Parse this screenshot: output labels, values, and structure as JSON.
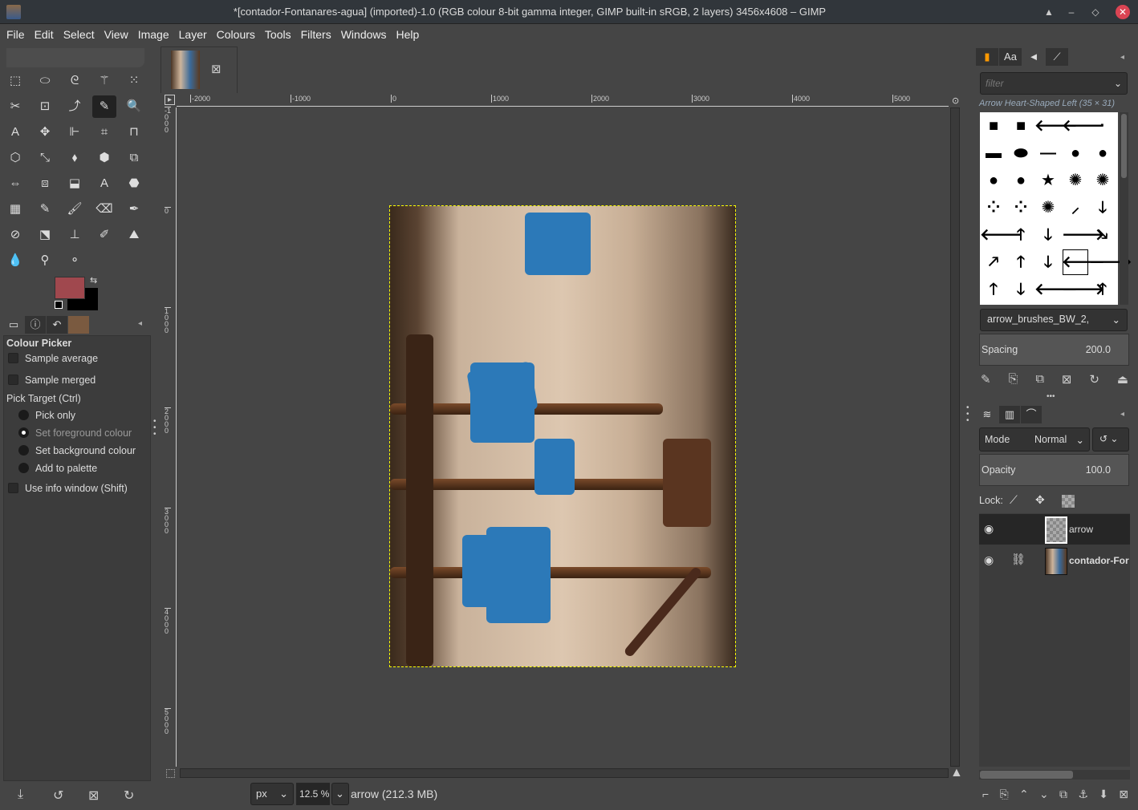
{
  "window": {
    "title": "*[contador-Fontanares-agua] (imported)-1.0 (RGB colour 8-bit gamma integer, GIMP built-in sRGB, 2 layers) 3456x4608 – GIMP"
  },
  "menu": [
    "File",
    "Edit",
    "Select",
    "View",
    "Image",
    "Layer",
    "Colours",
    "Tools",
    "Filters",
    "Windows",
    "Help"
  ],
  "tools": [
    "⬚",
    "⬭",
    "ᘓ",
    "⚚",
    "⁙",
    "✂",
    "⊡",
    "⤴",
    "✎",
    "🔍",
    "A",
    "✥",
    "⊩",
    "⌗",
    "⊓",
    "⬡",
    "⤡",
    "⬧",
    "⬢",
    "⧉",
    "⇔",
    "⧈",
    "⬓",
    "A",
    "⬣",
    "▦",
    "✎",
    "🖌",
    "⌫",
    "✒",
    "⊘",
    "⬔",
    "⊥",
    "✐",
    "⛰",
    "💧",
    "⚲",
    "⚬"
  ],
  "colors": {
    "foreground": "#a0484e",
    "background": "#000000"
  },
  "tool_options": {
    "title": "Colour Picker",
    "sample_average": "Sample average",
    "sample_merged": "Sample merged",
    "pick_target": "Pick Target  (Ctrl)",
    "radios": [
      {
        "label": "Pick only",
        "checked": false
      },
      {
        "label": "Set foreground colour",
        "checked": true
      },
      {
        "label": "Set background colour",
        "checked": false
      },
      {
        "label": "Add to palette",
        "checked": false
      }
    ],
    "use_info": "Use info window  (Shift)"
  },
  "ruler": {
    "h": [
      "-2000",
      "-1000",
      "0",
      "1000",
      "2000",
      "3000",
      "4000",
      "5000"
    ],
    "v": [
      "-1000",
      "0",
      "1000",
      "2000",
      "3000",
      "4000",
      "5000"
    ]
  },
  "status": {
    "unit": "px",
    "zoom": "12.5 %",
    "info": "arrow (212.3 MB)"
  },
  "brushes": {
    "filter_placeholder": "filter",
    "selected": "Arrow Heart-Shaped Left (35 × 31)",
    "tag": "arrow_brushes_BW_2,",
    "spacing_label": "Spacing",
    "spacing": "200.0",
    "grid": [
      "■",
      "■",
      "🡐",
      "🡐",
      "·",
      "▬",
      "⬬",
      "—",
      "●",
      "●",
      "●",
      "●",
      "★",
      "✺",
      "✺",
      "⁘",
      "⁘",
      "✺",
      "⸝",
      "🡓",
      "🡐",
      "🡑",
      "🡓",
      "🡒",
      "🡖",
      "🡕",
      "🡑",
      "🡓",
      "🡐",
      "🡒",
      "🡑",
      "🡓",
      "🡐",
      "🡒",
      "🡑"
    ]
  },
  "layers": {
    "mode_label": "Mode",
    "mode": "Normal",
    "opacity_label": "Opacity",
    "opacity": "100.0",
    "lock_label": "Lock:",
    "items": [
      {
        "name": "arrow",
        "selected": true
      },
      {
        "name": "contador-Fontanares-agua",
        "display": "contador-For",
        "selected": false
      }
    ]
  }
}
